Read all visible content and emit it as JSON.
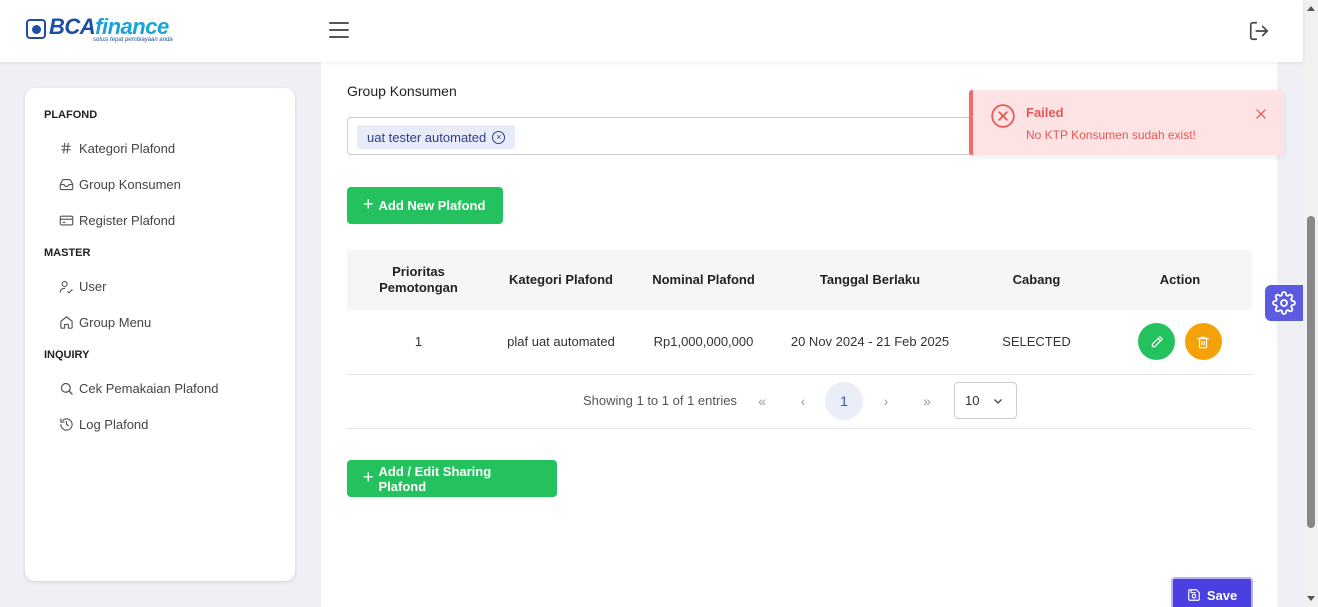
{
  "brand": {
    "logo_part1": "BCA",
    "logo_part2": "finance",
    "tagline": "solusi tepat pembiayaan anda"
  },
  "header": {
    "menu_icon": "hamburger-icon",
    "logout_icon": "logout-icon"
  },
  "sidebar": {
    "sections": [
      {
        "title": "PLAFOND",
        "items": [
          {
            "label": "Kategori Plafond",
            "icon": "hash-icon"
          },
          {
            "label": "Group Konsumen",
            "icon": "inbox-icon"
          },
          {
            "label": "Register Plafond",
            "icon": "card-icon"
          }
        ]
      },
      {
        "title": "MASTER",
        "items": [
          {
            "label": "User",
            "icon": "user-icon"
          },
          {
            "label": "Group Menu",
            "icon": "home-icon"
          }
        ]
      },
      {
        "title": "INQUIRY",
        "items": [
          {
            "label": "Cek Pemakaian Plafond",
            "icon": "search-icon"
          },
          {
            "label": "Log Plafond",
            "icon": "history-icon"
          }
        ]
      }
    ]
  },
  "form": {
    "group_konsumen_label": "Group Konsumen",
    "selected_chip": "uat tester automated",
    "add_plafond_button": "Add New Plafond",
    "add_sharing_button": "Add / Edit Sharing Plafond",
    "save_button": "Save"
  },
  "table": {
    "headers": [
      "Prioritas Pemotongan",
      "Kategori Plafond",
      "Nominal Plafond",
      "Tanggal Berlaku",
      "Cabang",
      "Action"
    ],
    "rows": [
      {
        "prioritas": "1",
        "kategori": "plaf uat automated",
        "nominal": "Rp1,000,000,000",
        "tanggal": "20 Nov 2024 - 21 Feb 2025",
        "cabang": "SELECTED"
      }
    ]
  },
  "pagination": {
    "info": "Showing 1 to 1 of 1 entries",
    "first": "«",
    "prev": "‹",
    "current_page": "1",
    "next": "›",
    "last": "»",
    "per_page": "10"
  },
  "toast": {
    "title": "Failed",
    "message": "No KTP Konsumen sudah exist!"
  },
  "colors": {
    "primary_green": "#23c25e",
    "warning_orange": "#f5a20a",
    "save_purple": "#4a3fe0",
    "error_red": "#e85656",
    "brand_blue": "#1c4fa1"
  }
}
